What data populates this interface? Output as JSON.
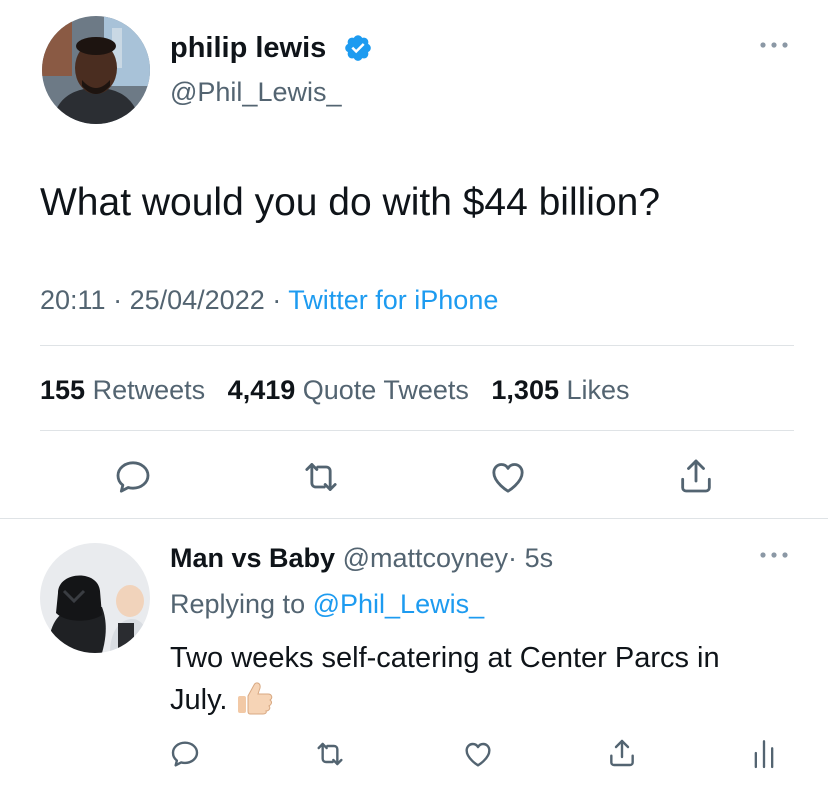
{
  "tweet": {
    "author_name": "philip lewis",
    "author_handle": "@Phil_Lewis_",
    "text": "What would you do with $44 billion?",
    "time": "20:11",
    "date": "25/04/2022",
    "separator": "·",
    "source": "Twitter for iPhone",
    "stats": {
      "retweets_count": "155",
      "retweets_label": "Retweets",
      "quotes_count": "4,419",
      "quotes_label": "Quote Tweets",
      "likes_count": "1,305",
      "likes_label": "Likes"
    },
    "actions": [
      "reply-icon",
      "retweet-icon",
      "like-icon",
      "share-icon"
    ]
  },
  "reply": {
    "author_name": "Man vs Baby",
    "author_handle": "@mattcoyney",
    "separator": "·",
    "age": "5s",
    "replying_prefix": "Replying to",
    "replying_to": "@Phil_Lewis_",
    "text_line1": "Two weeks self-catering at Center Parcs in",
    "text_line2": "July.",
    "emoji": "👍🏻",
    "actions": [
      "reply-icon",
      "retweet-icon",
      "like-icon",
      "share-icon",
      "analytics-icon"
    ]
  },
  "colors": {
    "accent": "#1d9bf0",
    "text": "#0f1419",
    "muted": "#536471",
    "divider": "#dfe3e6"
  }
}
